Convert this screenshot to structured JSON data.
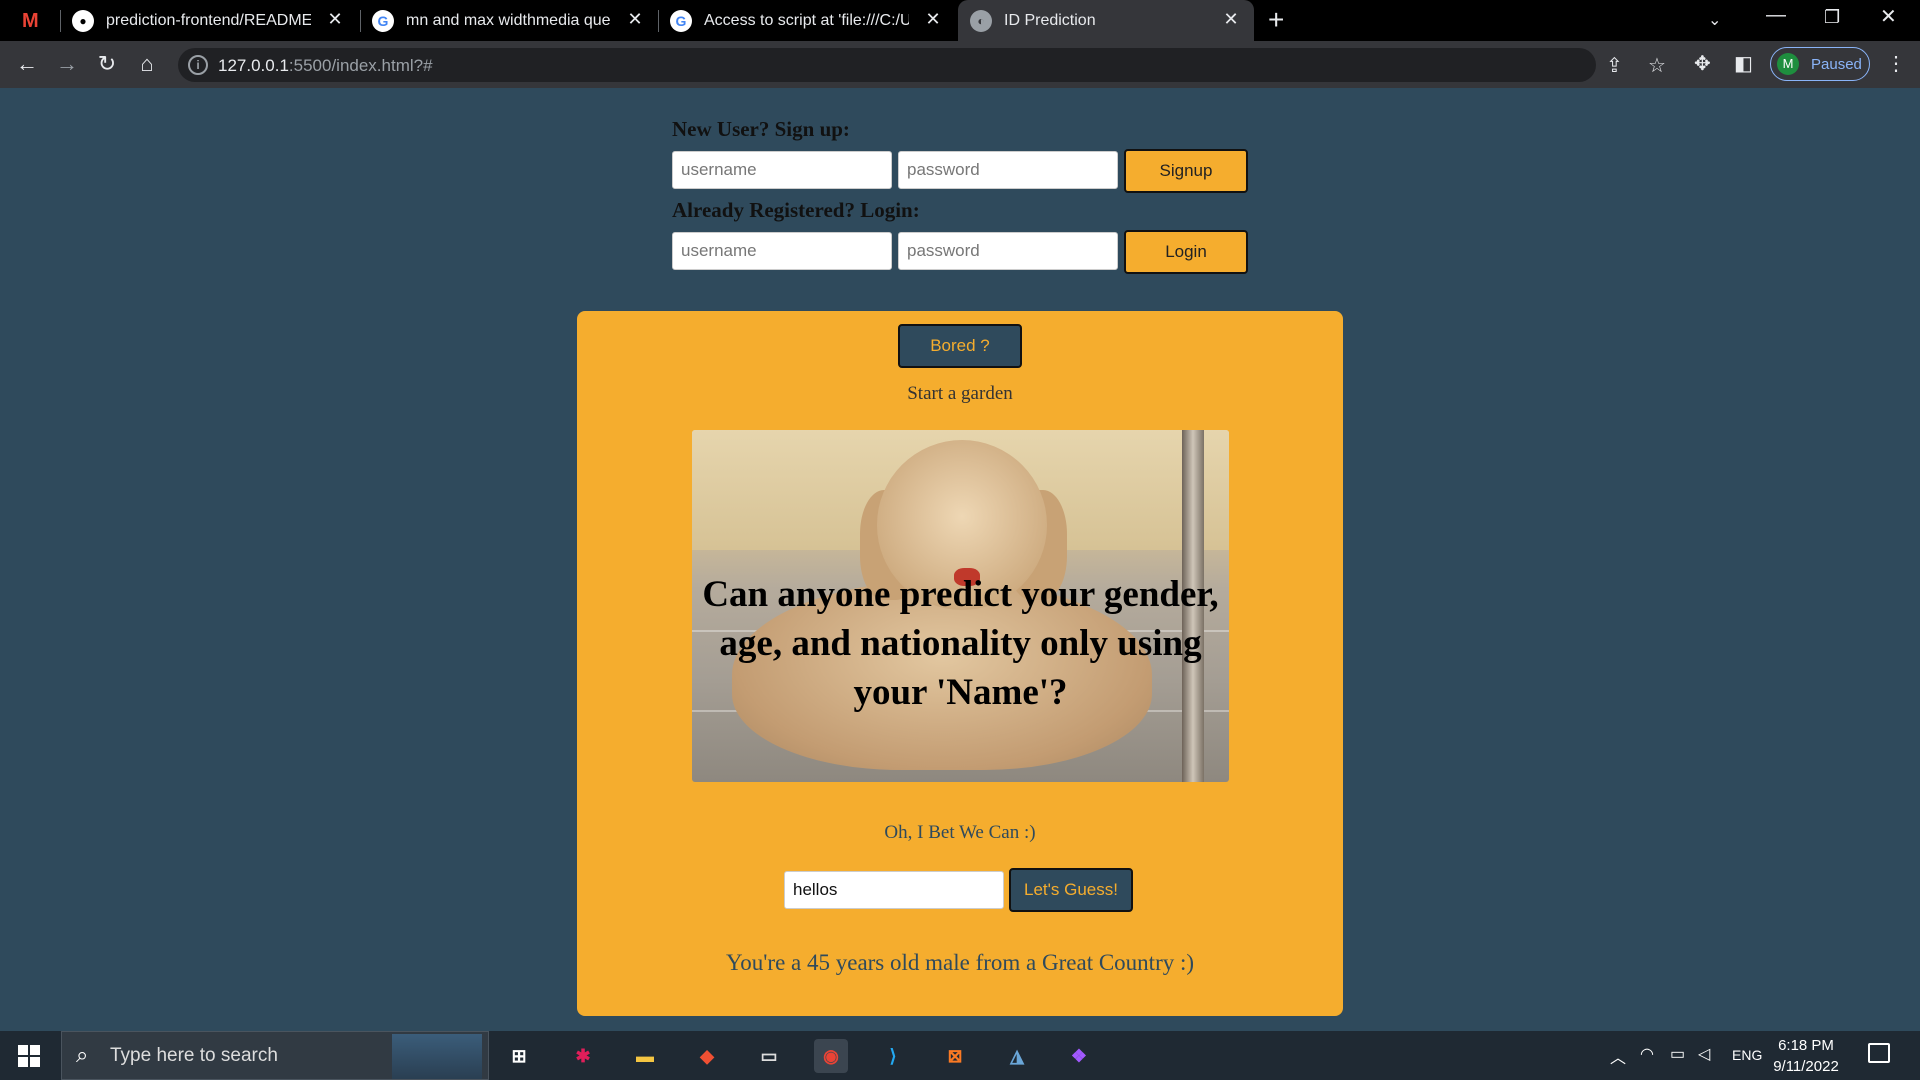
{
  "browser": {
    "tabs": [
      {
        "title": "prediction-frontend/README.md",
        "favicon": "github-icon"
      },
      {
        "title": "mn and max widthmedia query -",
        "favicon": "google-icon"
      },
      {
        "title": "Access to script at 'file:///C:/Users",
        "favicon": "google-icon"
      },
      {
        "title": "ID Prediction",
        "favicon": "globe-icon"
      }
    ],
    "url_host": "127.0.0.1",
    "url_rest": ":5500/index.html?#",
    "profile_initial": "M",
    "profile_status": "Paused"
  },
  "auth": {
    "signup_label": "New User? Sign up:",
    "signup_username_placeholder": "username",
    "signup_password_placeholder": "password",
    "signup_button": "Signup",
    "login_label": "Already Registered? Login:",
    "login_username_placeholder": "username",
    "login_password_placeholder": "password",
    "login_button": "Login"
  },
  "main": {
    "bored_button": "Bored ?",
    "activity_text": "Start a garden",
    "hero_text": "Can anyone predict your gender, age, and nationality only using your 'Name'?",
    "tagline": "Oh, I Bet We Can :)",
    "name_input_value": "hellos",
    "guess_button": "Let's Guess!",
    "result_text": "You're a 45 years old male from a Great Country :)"
  },
  "taskbar": {
    "search_placeholder": "Type here to search",
    "language": "ENG",
    "time": "6:18 PM",
    "date": "9/11/2022"
  },
  "colors": {
    "page_background": "#2f4a5c",
    "accent_orange": "#f5ad2e"
  }
}
